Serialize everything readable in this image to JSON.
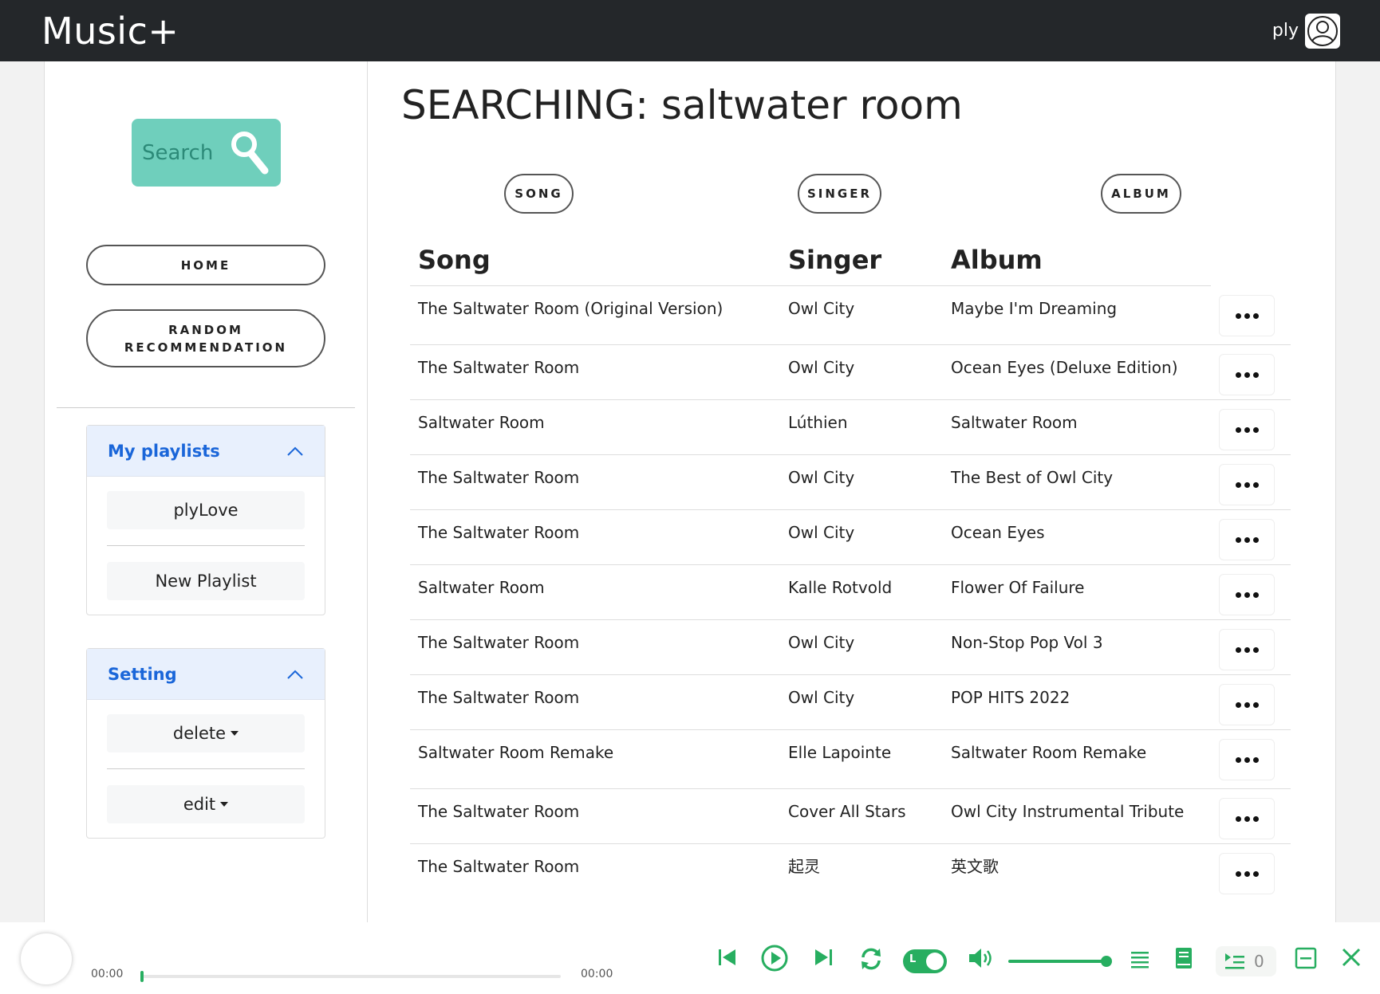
{
  "app": {
    "brand": "Music+",
    "username": "ply"
  },
  "sidebar": {
    "search_label": "Search",
    "home_label": "HOME",
    "random_label_line1": "RANDOM",
    "random_label_line2": "RECOMMENDATION",
    "playlists": {
      "title": "My playlists",
      "items": [
        "plyLove",
        "New Playlist"
      ]
    },
    "setting": {
      "title": "Setting",
      "items": [
        "delete",
        "edit"
      ]
    }
  },
  "main": {
    "title": "SEARCHING: saltwater room",
    "filters": [
      "SONG",
      "SINGER",
      "ALBUM"
    ],
    "columns": [
      "Song",
      "Singer",
      "Album"
    ],
    "rows": [
      {
        "song": "The Saltwater Room (Original Version)",
        "singer": "Owl City",
        "album": "Maybe I'm Dreaming"
      },
      {
        "song": "The Saltwater Room",
        "singer": "Owl City",
        "album": "Ocean Eyes (Deluxe Edition)"
      },
      {
        "song": "Saltwater Room",
        "singer": "Lúthien",
        "album": "Saltwater Room"
      },
      {
        "song": "The Saltwater Room",
        "singer": "Owl City",
        "album": "The Best of Owl City"
      },
      {
        "song": "The Saltwater Room",
        "singer": "Owl City",
        "album": "Ocean Eyes"
      },
      {
        "song": "Saltwater Room",
        "singer": "Kalle Rotvold",
        "album": "Flower Of Failure"
      },
      {
        "song": "The Saltwater Room",
        "singer": "Owl City",
        "album": "Non-Stop Pop Vol 3"
      },
      {
        "song": "The Saltwater Room",
        "singer": "Owl City",
        "album": "POP HITS 2022"
      },
      {
        "song": "Saltwater Room Remake",
        "singer": "Elle Lapointe",
        "album": "Saltwater Room Remake"
      },
      {
        "song": "The Saltwater Room",
        "singer": "Cover All Stars",
        "album": "Owl City Instrumental Tribute"
      },
      {
        "song": "The Saltwater Room",
        "singer": "起灵",
        "album": "英文歌"
      }
    ]
  },
  "player": {
    "time_current": "00:00",
    "time_total": "00:00",
    "progress": 0,
    "volume": 1.0,
    "loop_label": "L",
    "queue_count": "0",
    "accent_color": "#27ae60"
  }
}
